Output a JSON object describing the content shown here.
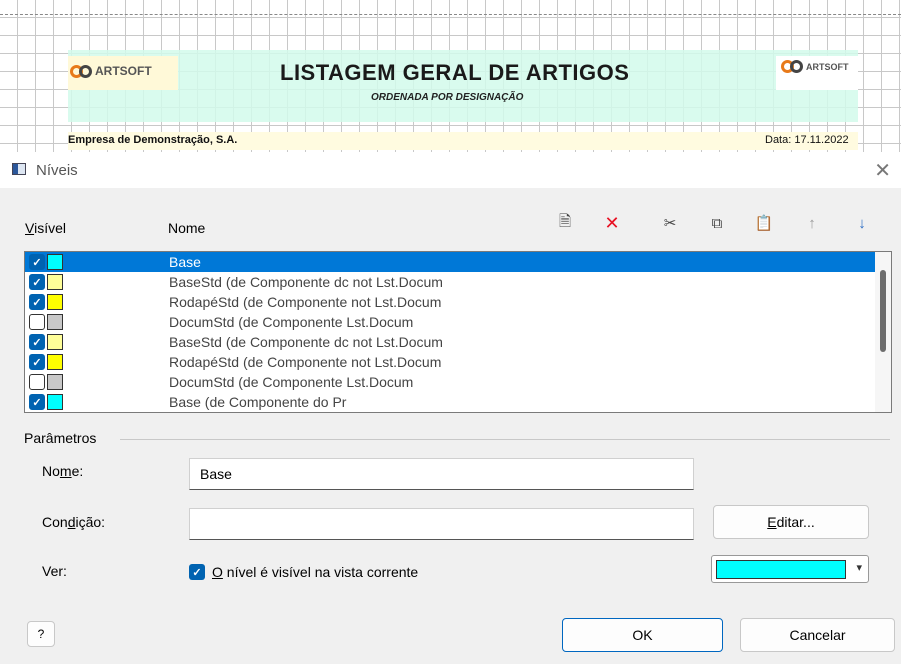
{
  "report": {
    "logo_left": "ARTSOFT",
    "logo_right": "ARTSOFT",
    "title": "LISTAGEM GERAL DE ARTIGOS",
    "subtitle": "ORDENADA POR DESIGNAÇÃO",
    "company": "Empresa de Demonstração, S.A.",
    "date": "Data: 17.11.2022"
  },
  "dialog": {
    "title": "Níveis",
    "close_glyph": "✕",
    "columns": {
      "visible_access": "V",
      "visible_rest": "isível",
      "name": "Nome"
    },
    "toolbar": [
      {
        "name": "new-icon",
        "glyph": "🗎",
        "color": "#444444"
      },
      {
        "name": "delete-icon",
        "glyph": "✕",
        "color": "#e81123"
      },
      {
        "name": "cut-icon",
        "glyph": "✂",
        "color": "#444444"
      },
      {
        "name": "copy-icon",
        "glyph": "⧉",
        "color": "#444444"
      },
      {
        "name": "paste-icon",
        "glyph": "📋",
        "color": "#444444"
      },
      {
        "name": "move-up-icon",
        "glyph": "↑",
        "color": "#9a9a9a"
      },
      {
        "name": "move-down-icon",
        "glyph": "↓",
        "color": "#2b6cc4"
      }
    ],
    "levels": [
      {
        "checked": true,
        "color": "#00ffff",
        "name": "Base",
        "selected": true
      },
      {
        "checked": true,
        "color": "#ffff99",
        "name": "BaseStd (de Componente dc not Lst.Docum",
        "selected": false
      },
      {
        "checked": true,
        "color": "#ffff00",
        "name": "RodapéStd (de Componente not Lst.Docum",
        "selected": false
      },
      {
        "checked": false,
        "color": "#c8c8c8",
        "name": "DocumStd (de Componente  Lst.Docum",
        "selected": false
      },
      {
        "checked": true,
        "color": "#ffff99",
        "name": "BaseStd (de Componente dc not Lst.Docum",
        "selected": false
      },
      {
        "checked": true,
        "color": "#ffff00",
        "name": "RodapéStd (de Componente not Lst.Docum",
        "selected": false
      },
      {
        "checked": false,
        "color": "#c8c8c8",
        "name": "DocumStd (de Componente  Lst.Docum",
        "selected": false
      },
      {
        "checked": true,
        "color": "#00ffff",
        "name": "Base (de Componente do Pr",
        "selected": false
      }
    ],
    "parameters": {
      "section_label": "Parâmetros",
      "name_label_pre": "No",
      "name_label_access": "m",
      "name_label_post": "e:",
      "name_value": "Base",
      "condition_label_pre": "Con",
      "condition_label_access": "d",
      "condition_label_post": "ição:",
      "condition_value": "",
      "edit_button_access": "E",
      "edit_button_rest": "ditar...",
      "view_label": "Ver:",
      "visible_checkbox_access": "O",
      "visible_checkbox_rest": " nível é visível na vista corrente",
      "visible_checked": true,
      "level_color": "#00ffff",
      "dropdown_arrow": "▾"
    },
    "help_glyph": "?",
    "ok_label": "OK",
    "cancel_label": "Cancelar"
  }
}
